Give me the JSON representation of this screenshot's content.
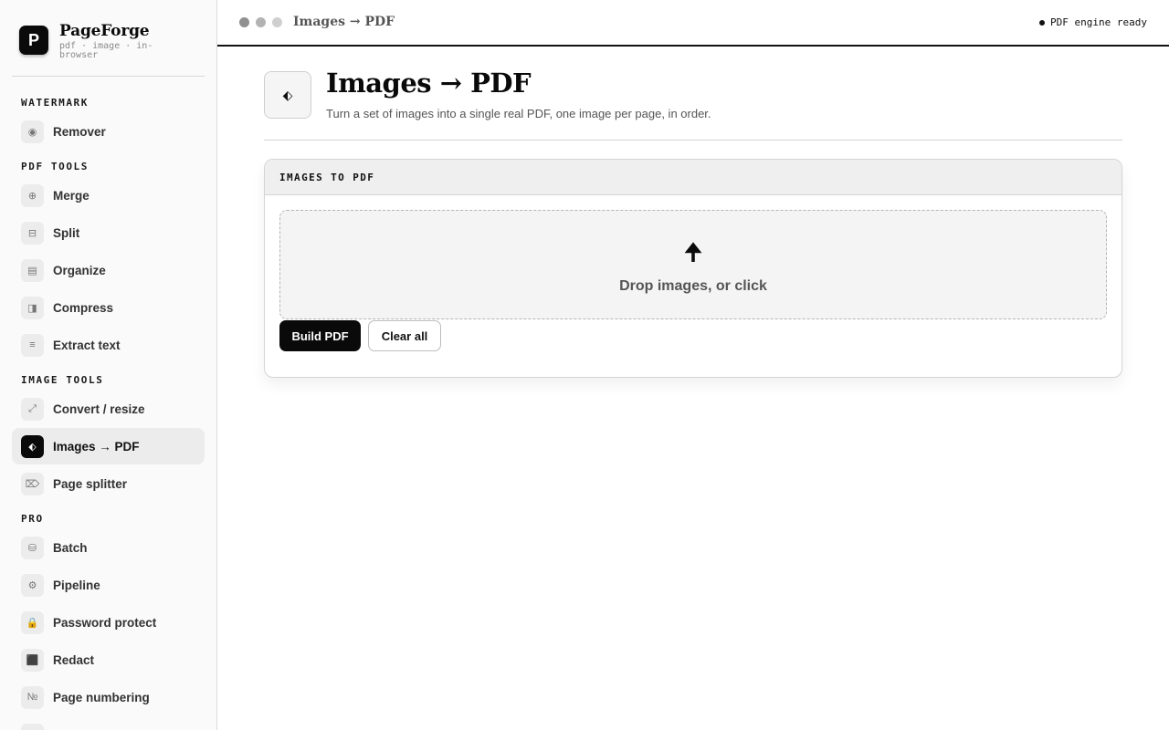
{
  "window": {
    "title": "Images → PDF"
  },
  "brand": {
    "logo_letter": "P",
    "name": "PageForge",
    "tagline": "pdf · image · in-browser"
  },
  "sidebar": {
    "sections": [
      {
        "label": "WATERMARK"
      },
      {
        "label": "PDF TOOLS"
      },
      {
        "label": "IMAGE TOOLS"
      },
      {
        "label": "PRO"
      }
    ],
    "items": [
      {
        "label": "Remover",
        "icon": "◉",
        "icon_name": "target-icon"
      },
      {
        "label": "Merge",
        "icon": "⊕",
        "icon_name": "merge-icon"
      },
      {
        "label": "Split",
        "icon": "⊟",
        "icon_name": "split-icon"
      },
      {
        "label": "Organize",
        "icon": "▤",
        "icon_name": "organize-icon"
      },
      {
        "label": "Compress",
        "icon": "◨",
        "icon_name": "compress-icon"
      },
      {
        "label": "Extract text",
        "icon": "≡",
        "icon_name": "text-icon"
      },
      {
        "label": "Convert / resize",
        "icon": "⤢",
        "icon_name": "resize-icon"
      },
      {
        "label": "Images → PDF",
        "icon": "⬖",
        "icon_name": "images-to-pdf-icon",
        "active": true
      },
      {
        "label": "Page splitter",
        "icon": "⌦",
        "icon_name": "page-splitter-icon"
      },
      {
        "label": "Batch",
        "icon": "⛁",
        "icon_name": "batch-icon"
      },
      {
        "label": "Pipeline",
        "icon": "⚙",
        "icon_name": "gear-icon"
      },
      {
        "label": "Password protect",
        "icon": "🔒",
        "icon_name": "lock-icon"
      },
      {
        "label": "Redact",
        "icon": "⬛",
        "icon_name": "redact-icon"
      },
      {
        "label": "Page numbering",
        "icon": "№",
        "icon_name": "numbering-icon"
      }
    ]
  },
  "topbar": {
    "title": "Images → PDF",
    "status": "PDF engine ready"
  },
  "page": {
    "icon": "⬖",
    "title": "Images → PDF",
    "subtitle": "Turn a set of images into a single real PDF, one image per page, in order."
  },
  "card": {
    "header": "IMAGES TO PDF",
    "drop_icon": "🠉",
    "drop_label": "Drop images, or click",
    "build_label": "Build PDF",
    "clear_label": "Clear all"
  },
  "colors": {
    "accent": "#0a0a0a",
    "active_item_bg": "#ececec",
    "sidebar_bg": "#fafafa"
  }
}
